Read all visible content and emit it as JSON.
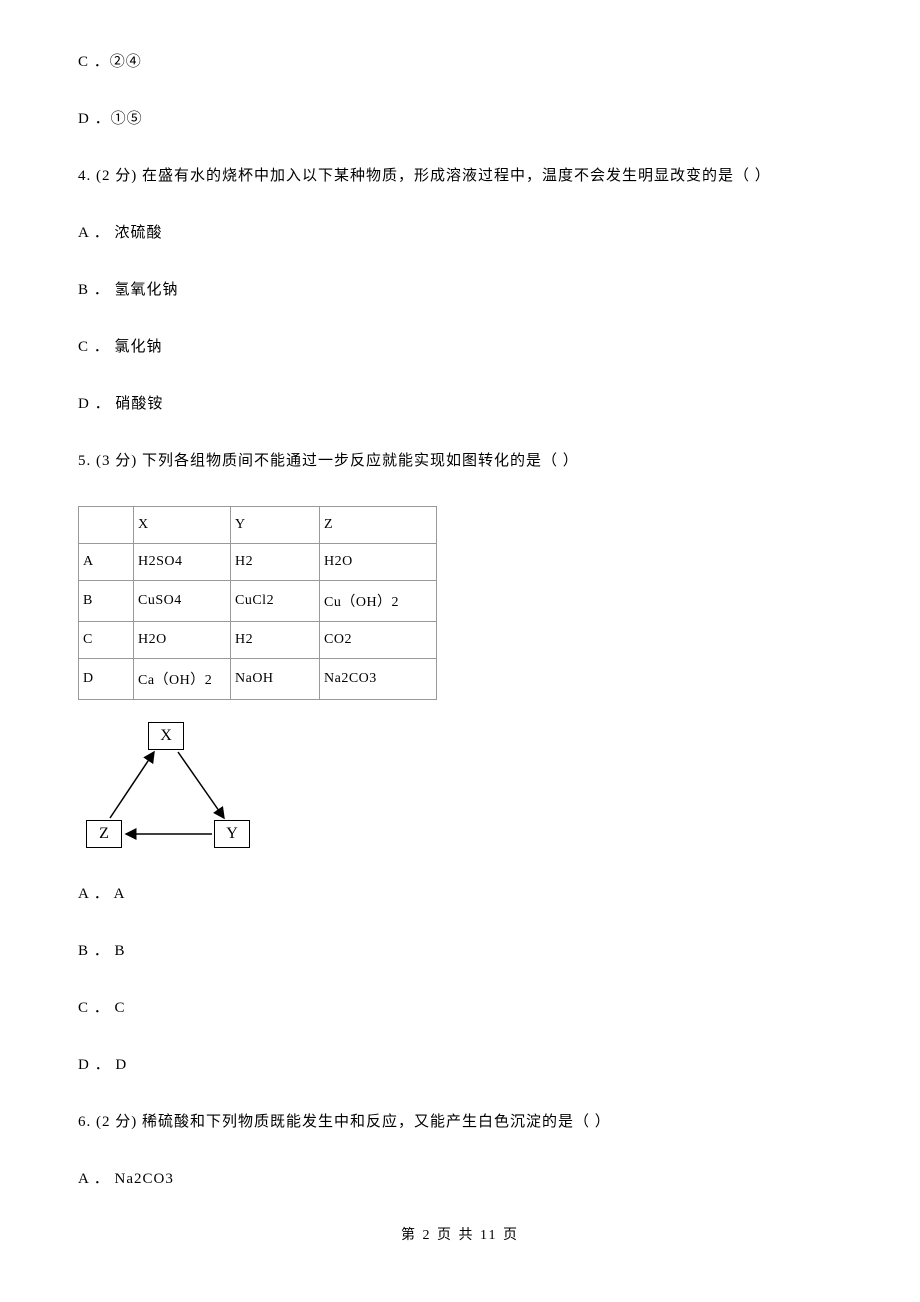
{
  "q3": {
    "optC": "C ．②④",
    "optD": "D ．①⑤"
  },
  "q4": {
    "stem": "4.  (2 分)   在盛有水的烧杯中加入以下某种物质，形成溶液过程中，温度不会发生明显改变的是（     ）",
    "optA": "A ． 浓硫酸",
    "optB": "B ． 氢氧化钠",
    "optC": "C ． 氯化钠",
    "optD": "D ． 硝酸铵"
  },
  "q5": {
    "stem": "5.  (3 分) 下列各组物质间不能通过一步反应就能实现如图转化的是（     ）",
    "table": {
      "header": [
        "",
        "X",
        "Y",
        "Z"
      ],
      "rows": [
        [
          "A",
          "H2SO4",
          "H2",
          "H2O"
        ],
        [
          "B",
          "CuSO4",
          "CuCl2",
          "Cu（OH）2"
        ],
        [
          "C",
          "H2O",
          "H2",
          "CO2"
        ],
        [
          "D",
          "Ca（OH）2",
          "NaOH",
          "Na2CO3"
        ]
      ]
    },
    "diagram": {
      "X": "X",
      "Y": "Y",
      "Z": "Z"
    },
    "optA": "A ． A",
    "optB": "B ． B",
    "optC": "C ． C",
    "optD": "D ． D"
  },
  "q6": {
    "stem": "6.  (2 分) 稀硫酸和下列物质既能发生中和反应，又能产生白色沉淀的是（     ）",
    "optA": "A ． Na2CO3"
  },
  "footer": "第 2 页 共 11 页"
}
